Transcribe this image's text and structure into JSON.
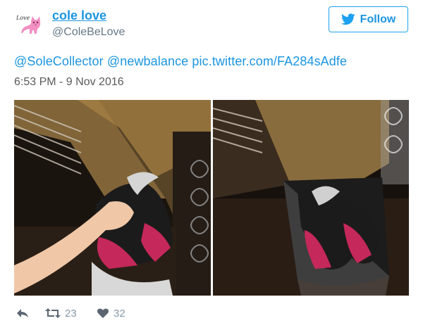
{
  "user": {
    "name": "cole love",
    "handle": "@ColeBeLove",
    "avatar_text": "Love"
  },
  "follow_label": "Follow",
  "tweet": {
    "mention1": "@SoleCollector",
    "mention2": "@newbalance",
    "link": "pic.twitter.com/FA284sAdfe",
    "timestamp": "6:53 PM - 9 Nov 2016"
  },
  "actions": {
    "retweets": "23",
    "likes": "32"
  },
  "icons": {
    "follow": "twitter-bird-icon",
    "reply": "reply-icon",
    "retweet": "retweet-icon",
    "like": "heart-icon"
  },
  "colors": {
    "link": "#1b95e0",
    "muted": "#657786",
    "icon": "#8899a6",
    "border": "#1da1f2"
  }
}
